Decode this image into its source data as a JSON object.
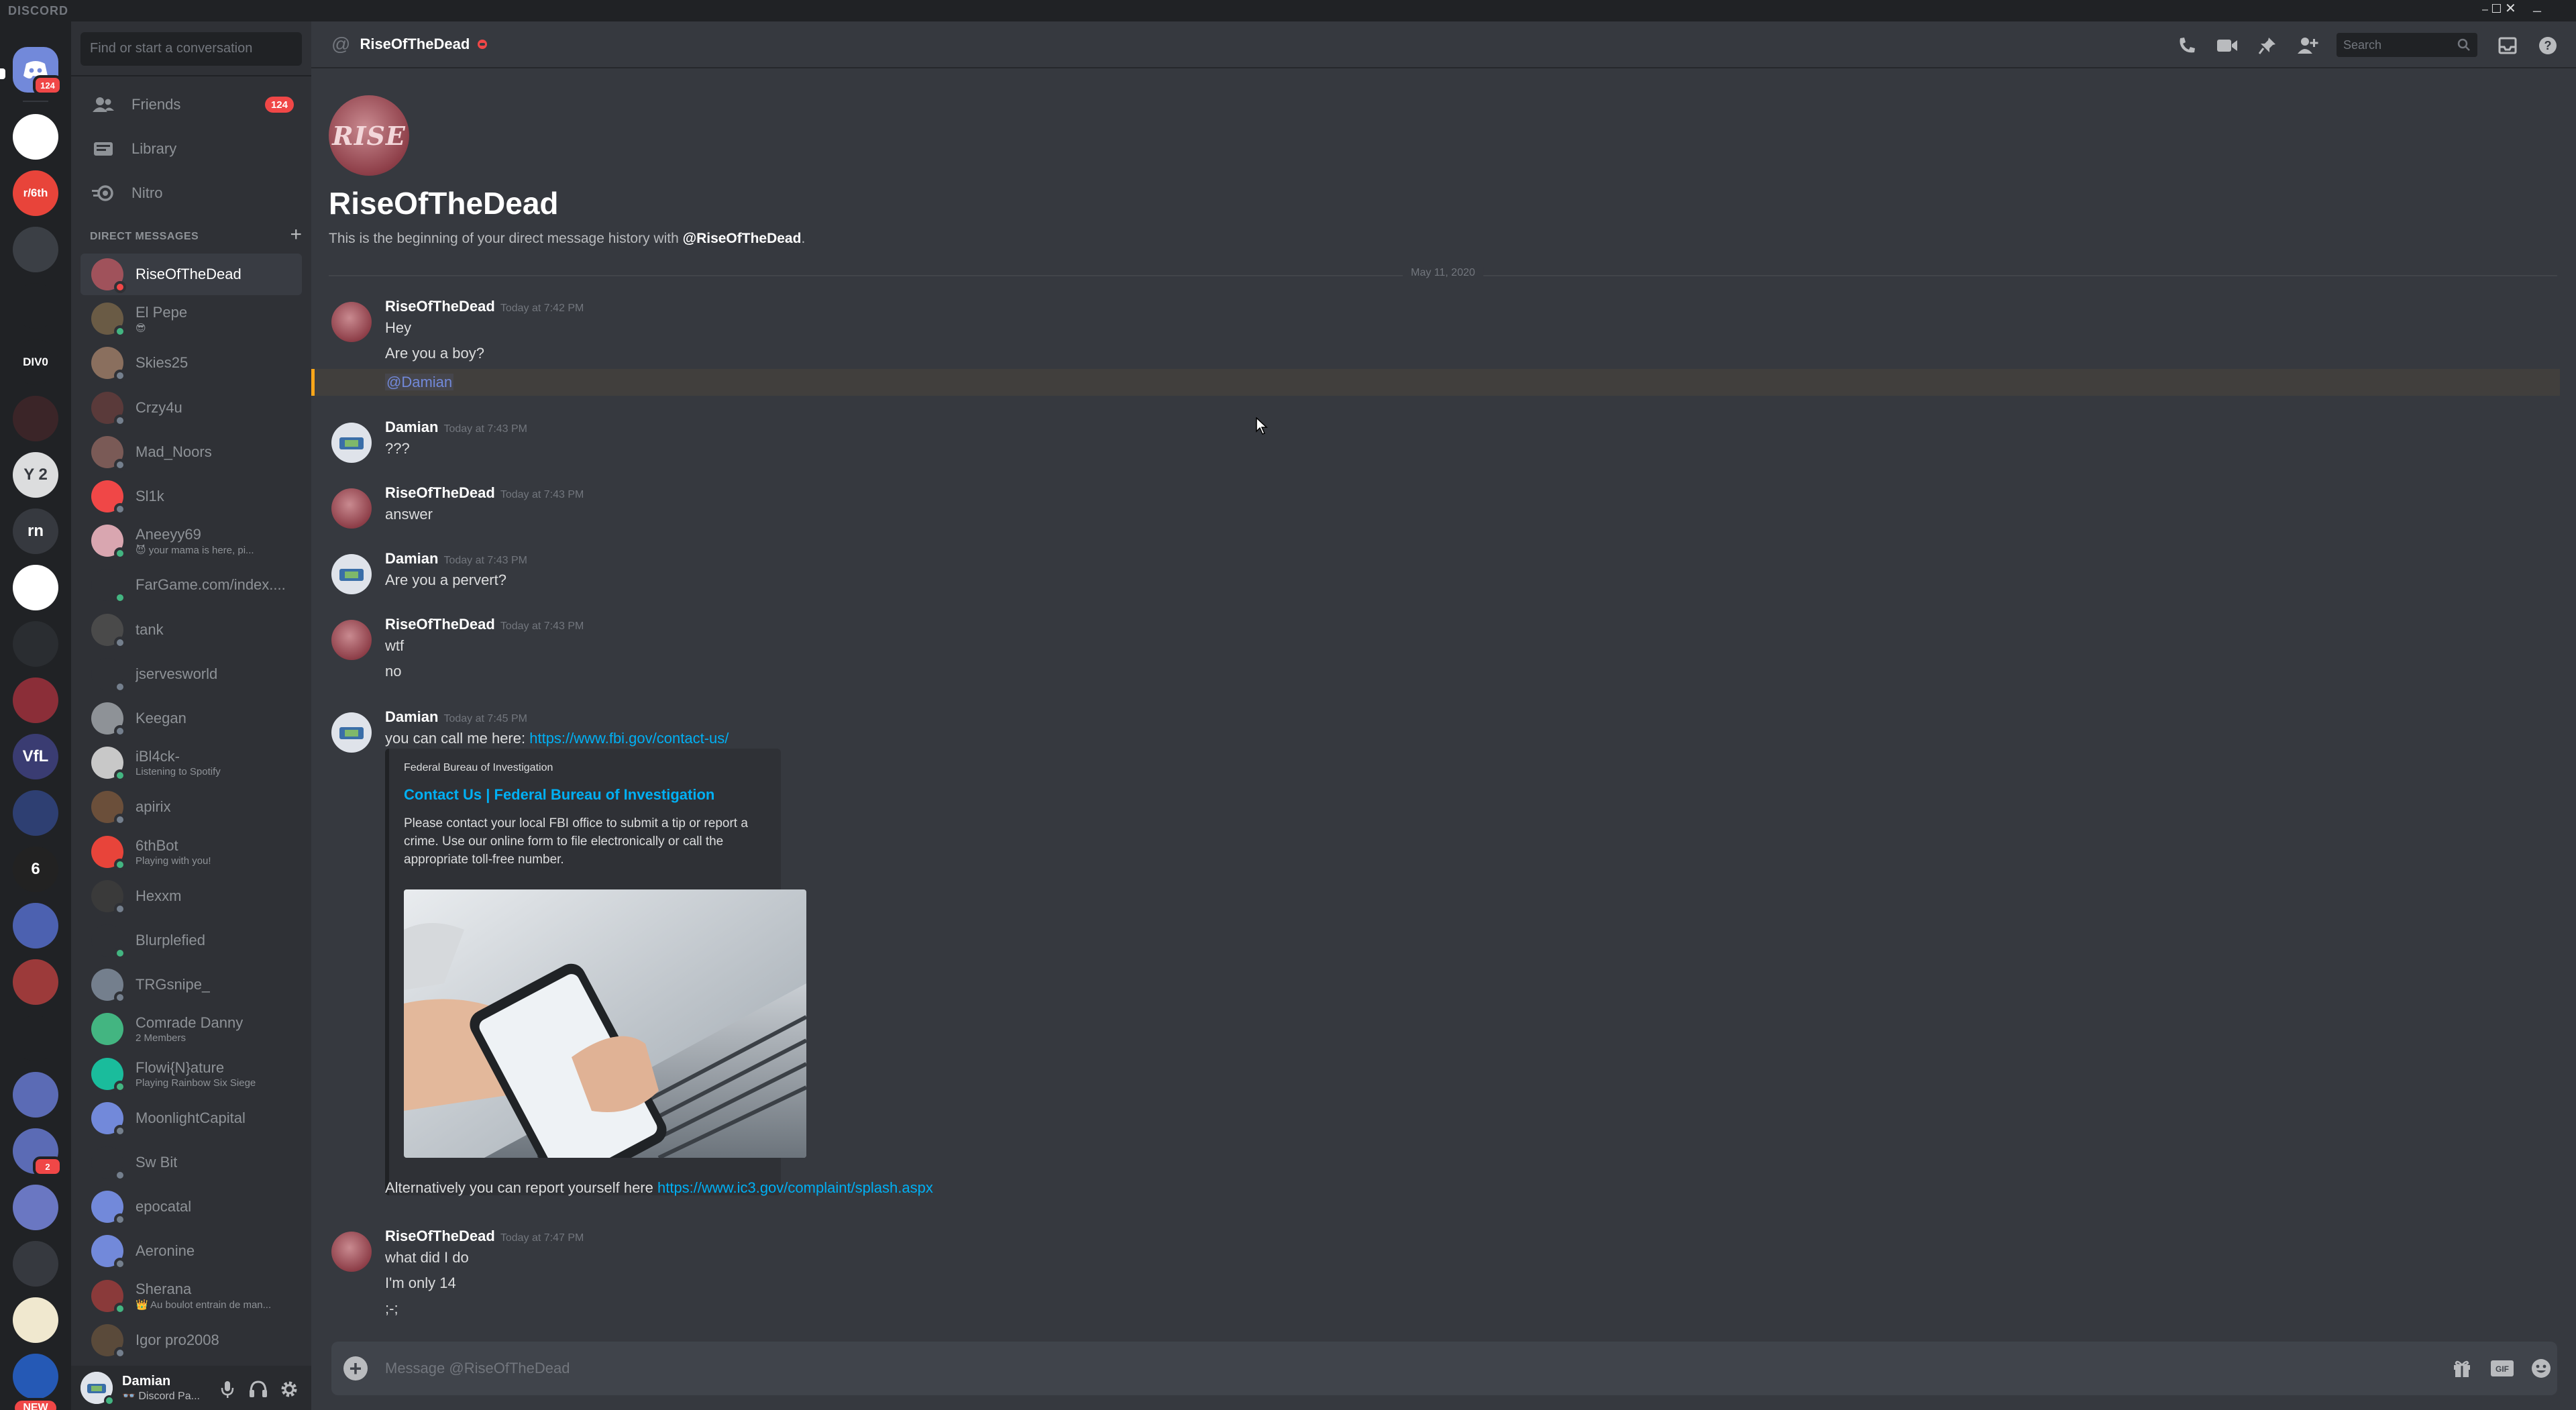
{
  "window": {
    "brand": "DISCORD",
    "controls": [
      "–",
      "☐",
      "✕"
    ]
  },
  "guilds": {
    "home_badge": "124",
    "items": [
      {
        "name": "guild-analytics",
        "label": "",
        "color": "#ffffff"
      },
      {
        "name": "guild-r6th",
        "label": "r/6th",
        "color": "#e8443a"
      },
      {
        "name": "guild-anime",
        "label": "",
        "color": "#3b3f45"
      },
      {
        "name": "guild-valorant",
        "label": "",
        "color": "#202225"
      },
      {
        "name": "guild-div0",
        "label": "DIV0",
        "color": "#202225"
      },
      {
        "name": "guild-redart",
        "label": "",
        "color": "#3b2528"
      },
      {
        "name": "guild-y2",
        "label": "Y 2",
        "color": "#dcddde"
      },
      {
        "name": "guild-rn",
        "label": "rn",
        "color": "#36393f"
      },
      {
        "name": "guild-jar",
        "label": "",
        "color": "#ffffff"
      },
      {
        "name": "guild-dark",
        "label": "",
        "color": "#2a2d31"
      },
      {
        "name": "guild-virus",
        "label": "",
        "color": "#8b2e38"
      },
      {
        "name": "guild-vfl",
        "label": "VfL",
        "color": "#3a3c72"
      },
      {
        "name": "guild-mascot",
        "label": "",
        "color": "#2e3f72"
      },
      {
        "name": "guild-r6-six",
        "label": "6",
        "color": "#222222"
      },
      {
        "name": "guild-bot-blue",
        "label": "",
        "color": "#4c61b0"
      },
      {
        "name": "guild-shield",
        "label": "",
        "color": "#9c3a3a"
      },
      {
        "name": "guild-folder",
        "label": "",
        "color": "#202225"
      },
      {
        "name": "guild-hamster",
        "label": "",
        "color": "#5b6bb5"
      },
      {
        "name": "guild-discord-2",
        "label": "",
        "color": "#5b6bb5",
        "badge": "2"
      },
      {
        "name": "guild-pepe",
        "label": "",
        "color": "#6a77c2"
      },
      {
        "name": "guild-watch",
        "label": "",
        "color": "#36393f"
      },
      {
        "name": "guild-cartoon",
        "label": "",
        "color": "#f0e8cf"
      },
      {
        "name": "guild-disney",
        "label": "",
        "color": "#2559b5"
      }
    ],
    "new_label": "NEW"
  },
  "sidebar": {
    "search_placeholder": "Find or start a conversation",
    "nav": [
      {
        "label": "Friends",
        "badge": "124"
      },
      {
        "label": "Library"
      },
      {
        "label": "Nitro"
      }
    ],
    "dm_header": "DIRECT MESSAGES",
    "dms": [
      {
        "name": "RiseOfTheDead",
        "color": "#a0525b",
        "status": "#f04747",
        "active": true
      },
      {
        "name": "El Pepe",
        "sub": "😎",
        "color": "#6a5b45",
        "status": "#43b581"
      },
      {
        "name": "Skies25",
        "color": "#8a6f5e",
        "status": "#747f8d"
      },
      {
        "name": "Crzy4u",
        "color": "#5a3a3a",
        "status": "#747f8d"
      },
      {
        "name": "Mad_Noors",
        "color": "#7a5a56",
        "status": "#747f8d"
      },
      {
        "name": "Sl1k",
        "color": "#f04747",
        "status": "#747f8d"
      },
      {
        "name": "Aneeyy69",
        "sub": "😈 your mama is here, pi...",
        "color": "#d9a6b0",
        "status": "#43b581"
      },
      {
        "name": "FarGame.com/index....",
        "color": "#2f3136",
        "status": "#43b581"
      },
      {
        "name": "tank",
        "color": "#4a4a4a",
        "status": "#747f8d"
      },
      {
        "name": "jservesworld",
        "color": "#2f3136",
        "status": "#747f8d"
      },
      {
        "name": "Keegan",
        "color": "#8e9297",
        "status": "#747f8d"
      },
      {
        "name": "iBl4ck-",
        "sub": "Listening to Spotify",
        "color": "#c8c8c8",
        "status": "#43b581"
      },
      {
        "name": "apirix",
        "color": "#6b4f3a",
        "status": "#747f8d"
      },
      {
        "name": "6thBot",
        "sub": "Playing with you!",
        "color": "#e8443a",
        "status": "#43b581"
      },
      {
        "name": "Hexxm",
        "color": "#3a3a3a",
        "status": "#747f8d"
      },
      {
        "name": "Blurplefied",
        "color": "#2f3136",
        "status": "#43b581"
      },
      {
        "name": "TRGsnipe_",
        "color": "#747f8d",
        "status": "#747f8d"
      },
      {
        "name": "Comrade Danny",
        "sub": "2 Members",
        "color": "#43b581",
        "status": ""
      },
      {
        "name": "Flowi{N}ature",
        "sub": "Playing Rainbow Six Siege",
        "color": "#1abc9c",
        "status": "#43b581"
      },
      {
        "name": "MoonlightCapital",
        "color": "#7289da",
        "status": "#747f8d"
      },
      {
        "name": "Sw Bit",
        "color": "#2f3136",
        "status": "#747f8d"
      },
      {
        "name": "epocatal",
        "color": "#7289da",
        "status": "#747f8d"
      },
      {
        "name": "Aeronine",
        "color": "#7289da",
        "status": "#747f8d"
      },
      {
        "name": "Sherana",
        "sub": "👑 Au boulot entrain de man...",
        "color": "#8a3a3a",
        "status": "#43b581"
      },
      {
        "name": "Igor pro2008",
        "color": "#5a4a3a",
        "status": "#747f8d"
      }
    ],
    "user": {
      "name": "Damian",
      "sub": "👓 Discord Pa..."
    }
  },
  "chat": {
    "header_title": "RiseOfTheDead",
    "search_placeholder": "Search",
    "intro": {
      "avatar_text": "RISE",
      "title": "RiseOfTheDead",
      "line_prefix": "This is the beginning of your direct message history with ",
      "line_user": "@RiseOfTheDead",
      "line_suffix": "."
    },
    "date_divider": "May 11, 2020",
    "groups": [
      {
        "author": "RiseOfTheDead",
        "time": "Today at 7:42 PM",
        "lines": [
          "Hey",
          "Are you a boy?"
        ],
        "mention_line": "@Damian"
      },
      {
        "author": "Damian",
        "time": "Today at 7:43 PM",
        "lines": [
          "???"
        ]
      },
      {
        "author": "RiseOfTheDead",
        "time": "Today at 7:43 PM",
        "lines": [
          "answer"
        ]
      },
      {
        "author": "Damian",
        "time": "Today at 7:43 PM",
        "lines": [
          "Are you a pervert?"
        ]
      },
      {
        "author": "RiseOfTheDead",
        "time": "Today at 7:43 PM",
        "lines": [
          "wtf",
          "no"
        ]
      },
      {
        "author": "Damian",
        "time": "Today at 7:45 PM",
        "line_prefix": "you can call me here: ",
        "link": "https://www.fbi.gov/contact-us/"
      },
      {
        "author": "RiseOfTheDead",
        "time": "Today at 7:47 PM",
        "lines": [
          "what did I do",
          "I'm only 14",
          ";-;"
        ]
      }
    ],
    "embed": {
      "provider": "Federal Bureau of Investigation",
      "title": "Contact Us | Federal Bureau of Investigation",
      "description": "Please contact your local FBI office to submit a tip or report a crime. Use our online form to file electronically or call the appropriate toll-free number."
    },
    "followup": {
      "prefix": "Alternatively you can report yourself here ",
      "link": "https://www.ic3.gov/complaint/splash.aspx"
    },
    "composer_placeholder": "Message @RiseOfTheDead"
  }
}
